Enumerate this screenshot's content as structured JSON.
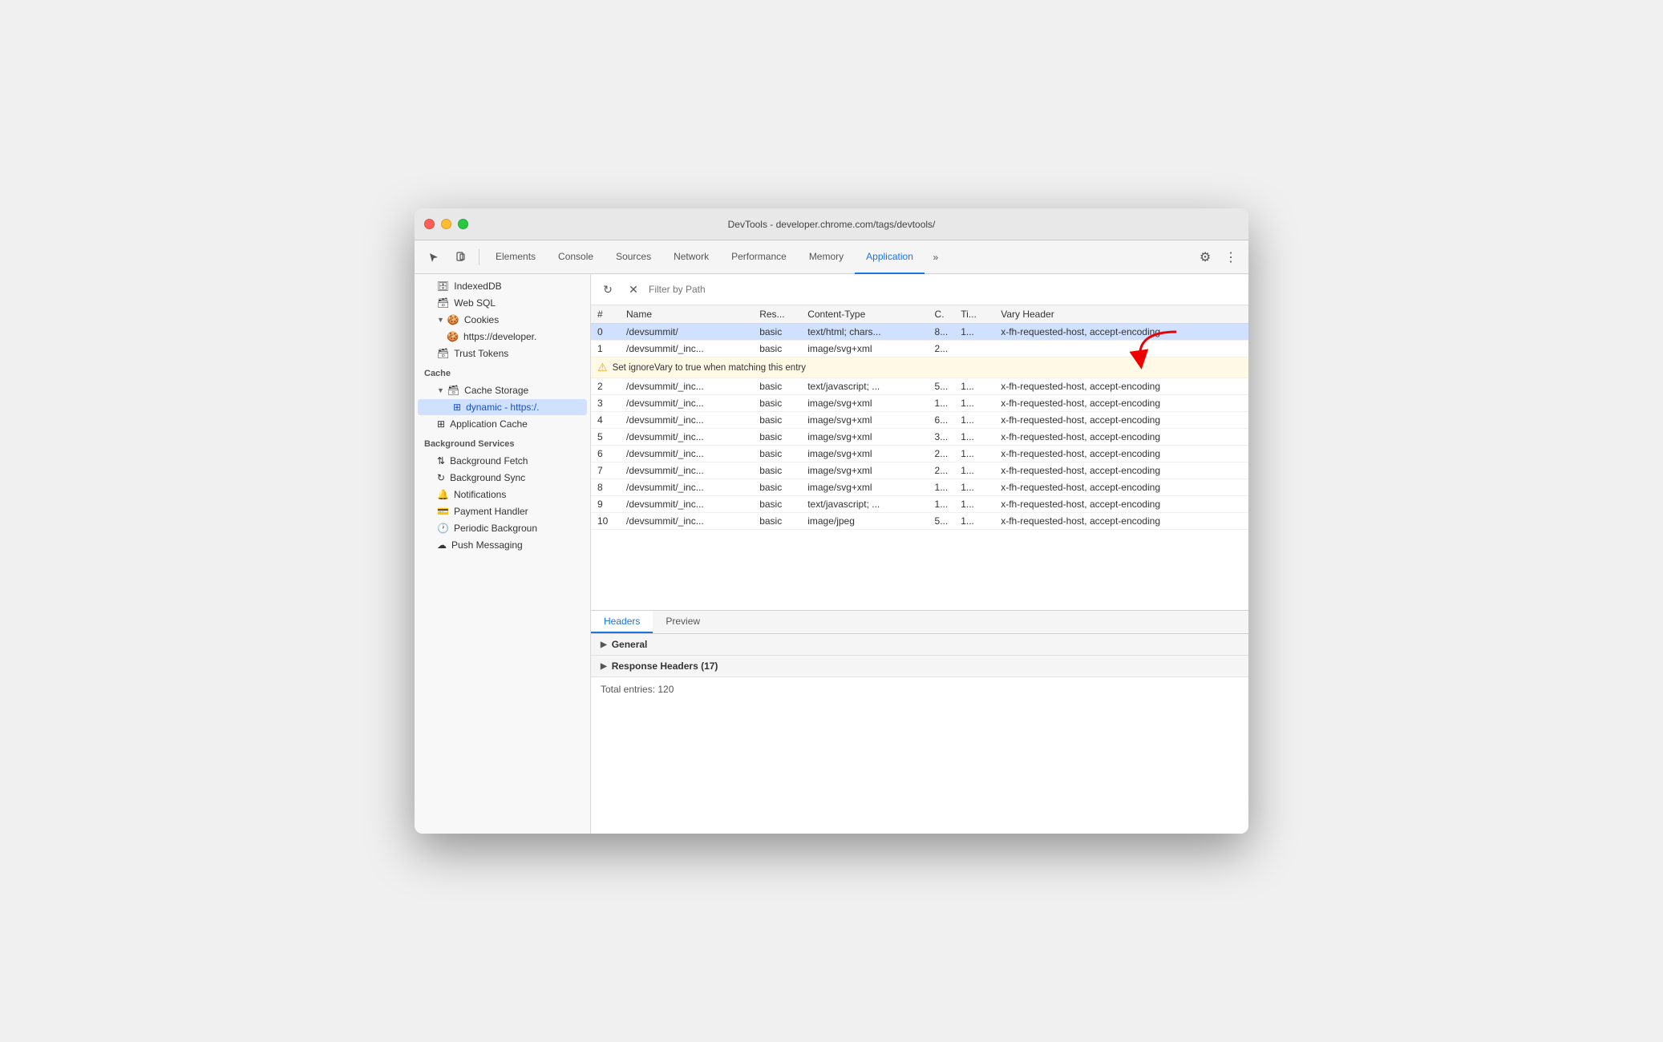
{
  "window": {
    "title": "DevTools - developer.chrome.com/tags/devtools/"
  },
  "tabs": [
    {
      "id": "elements",
      "label": "Elements",
      "active": false
    },
    {
      "id": "console",
      "label": "Console",
      "active": false
    },
    {
      "id": "sources",
      "label": "Sources",
      "active": false
    },
    {
      "id": "network",
      "label": "Network",
      "active": false
    },
    {
      "id": "performance",
      "label": "Performance",
      "active": false
    },
    {
      "id": "memory",
      "label": "Memory",
      "active": false
    },
    {
      "id": "application",
      "label": "Application",
      "active": true
    }
  ],
  "sidebar": {
    "items": [
      {
        "id": "indexeddb",
        "label": "IndexedDB",
        "icon": "🗄",
        "indent": 1,
        "hasArrow": false
      },
      {
        "id": "websql",
        "label": "Web SQL",
        "icon": "🗃",
        "indent": 1,
        "hasArrow": false
      },
      {
        "id": "cookies",
        "label": "Cookies",
        "icon": "🍪",
        "indent": 1,
        "hasArrow": true,
        "expanded": true
      },
      {
        "id": "cookies-dev",
        "label": "https://developer.",
        "icon": "🍪",
        "indent": 2,
        "hasArrow": false
      },
      {
        "id": "trust-tokens",
        "label": "Trust Tokens",
        "icon": "🗃",
        "indent": 1,
        "hasArrow": false
      },
      {
        "id": "cache-header",
        "label": "Cache",
        "isHeader": true
      },
      {
        "id": "cache-storage",
        "label": "Cache Storage",
        "icon": "🗃",
        "indent": 1,
        "hasArrow": true,
        "expanded": true
      },
      {
        "id": "dynamic",
        "label": "dynamic - https:/.",
        "icon": "⊞",
        "indent": 2,
        "hasArrow": false,
        "selected": true
      },
      {
        "id": "app-cache",
        "label": "Application Cache",
        "icon": "⊞",
        "indent": 1,
        "hasArrow": false
      },
      {
        "id": "bg-services-header",
        "label": "Background Services",
        "isHeader": true
      },
      {
        "id": "bg-fetch",
        "label": "Background Fetch",
        "icon": "⇅",
        "indent": 1,
        "hasArrow": false
      },
      {
        "id": "bg-sync",
        "label": "Background Sync",
        "icon": "↻",
        "indent": 1,
        "hasArrow": false
      },
      {
        "id": "notifications",
        "label": "Notifications",
        "icon": "🔔",
        "indent": 1,
        "hasArrow": false
      },
      {
        "id": "payment-handler",
        "label": "Payment Handler",
        "icon": "💳",
        "indent": 1,
        "hasArrow": false
      },
      {
        "id": "periodic-bg",
        "label": "Periodic Backgroun",
        "icon": "🕐",
        "indent": 1,
        "hasArrow": false
      },
      {
        "id": "push-messaging",
        "label": "Push Messaging",
        "icon": "☁",
        "indent": 1,
        "hasArrow": false
      }
    ]
  },
  "filter": {
    "placeholder": "Filter by Path"
  },
  "table": {
    "columns": [
      "#",
      "Name",
      "Res...",
      "Content-Type",
      "C.",
      "Ti...",
      "Vary Header"
    ],
    "rows": [
      {
        "hash": "0",
        "name": "/devsummit/",
        "res": "basic",
        "ct": "text/html; chars...",
        "c": "8...",
        "ti": "1...",
        "vh": "x-fh-requested-host, accept-encoding",
        "selected": true
      },
      {
        "hash": "1",
        "name": "/devsummit/_inc...",
        "res": "basic",
        "ct": "image/svg+xml",
        "c": "2...",
        "ti": "",
        "vh": "",
        "tooltip": true
      },
      {
        "hash": "2",
        "name": "/devsummit/_inc...",
        "res": "basic",
        "ct": "text/javascript; ...",
        "c": "5...",
        "ti": "1...",
        "vh": "x-fh-requested-host, accept-encoding"
      },
      {
        "hash": "3",
        "name": "/devsummit/_inc...",
        "res": "basic",
        "ct": "image/svg+xml",
        "c": "1...",
        "ti": "1...",
        "vh": "x-fh-requested-host, accept-encoding"
      },
      {
        "hash": "4",
        "name": "/devsummit/_inc...",
        "res": "basic",
        "ct": "image/svg+xml",
        "c": "6...",
        "ti": "1...",
        "vh": "x-fh-requested-host, accept-encoding"
      },
      {
        "hash": "5",
        "name": "/devsummit/_inc...",
        "res": "basic",
        "ct": "image/svg+xml",
        "c": "3...",
        "ti": "1...",
        "vh": "x-fh-requested-host, accept-encoding"
      },
      {
        "hash": "6",
        "name": "/devsummit/_inc...",
        "res": "basic",
        "ct": "image/svg+xml",
        "c": "2...",
        "ti": "1...",
        "vh": "x-fh-requested-host, accept-encoding"
      },
      {
        "hash": "7",
        "name": "/devsummit/_inc...",
        "res": "basic",
        "ct": "image/svg+xml",
        "c": "2...",
        "ti": "1...",
        "vh": "x-fh-requested-host, accept-encoding"
      },
      {
        "hash": "8",
        "name": "/devsummit/_inc...",
        "res": "basic",
        "ct": "image/svg+xml",
        "c": "1...",
        "ti": "1...",
        "vh": "x-fh-requested-host, accept-encoding"
      },
      {
        "hash": "9",
        "name": "/devsummit/_inc...",
        "res": "basic",
        "ct": "text/javascript; ...",
        "c": "1...",
        "ti": "1...",
        "vh": "x-fh-requested-host, accept-encoding"
      },
      {
        "hash": "10",
        "name": "/devsummit/_inc...",
        "res": "basic",
        "ct": "image/jpeg",
        "c": "5...",
        "ti": "1...",
        "vh": "x-fh-requested-host, accept-encoding"
      }
    ],
    "tooltip": {
      "icon": "⚠",
      "text": "Set ignoreVary to true when matching this entry"
    }
  },
  "bottom_panel": {
    "tabs": [
      "Headers",
      "Preview"
    ],
    "active_tab": "Headers",
    "sections": [
      {
        "id": "general",
        "label": "General"
      },
      {
        "id": "response-headers",
        "label": "Response Headers (17)"
      }
    ],
    "total_entries": "Total entries: 120"
  },
  "colors": {
    "active_tab": "#1a73e8",
    "selected_row": "#d0e0ff",
    "tooltip_bg": "#fff9e6",
    "tooltip_icon": "#f5a623"
  }
}
